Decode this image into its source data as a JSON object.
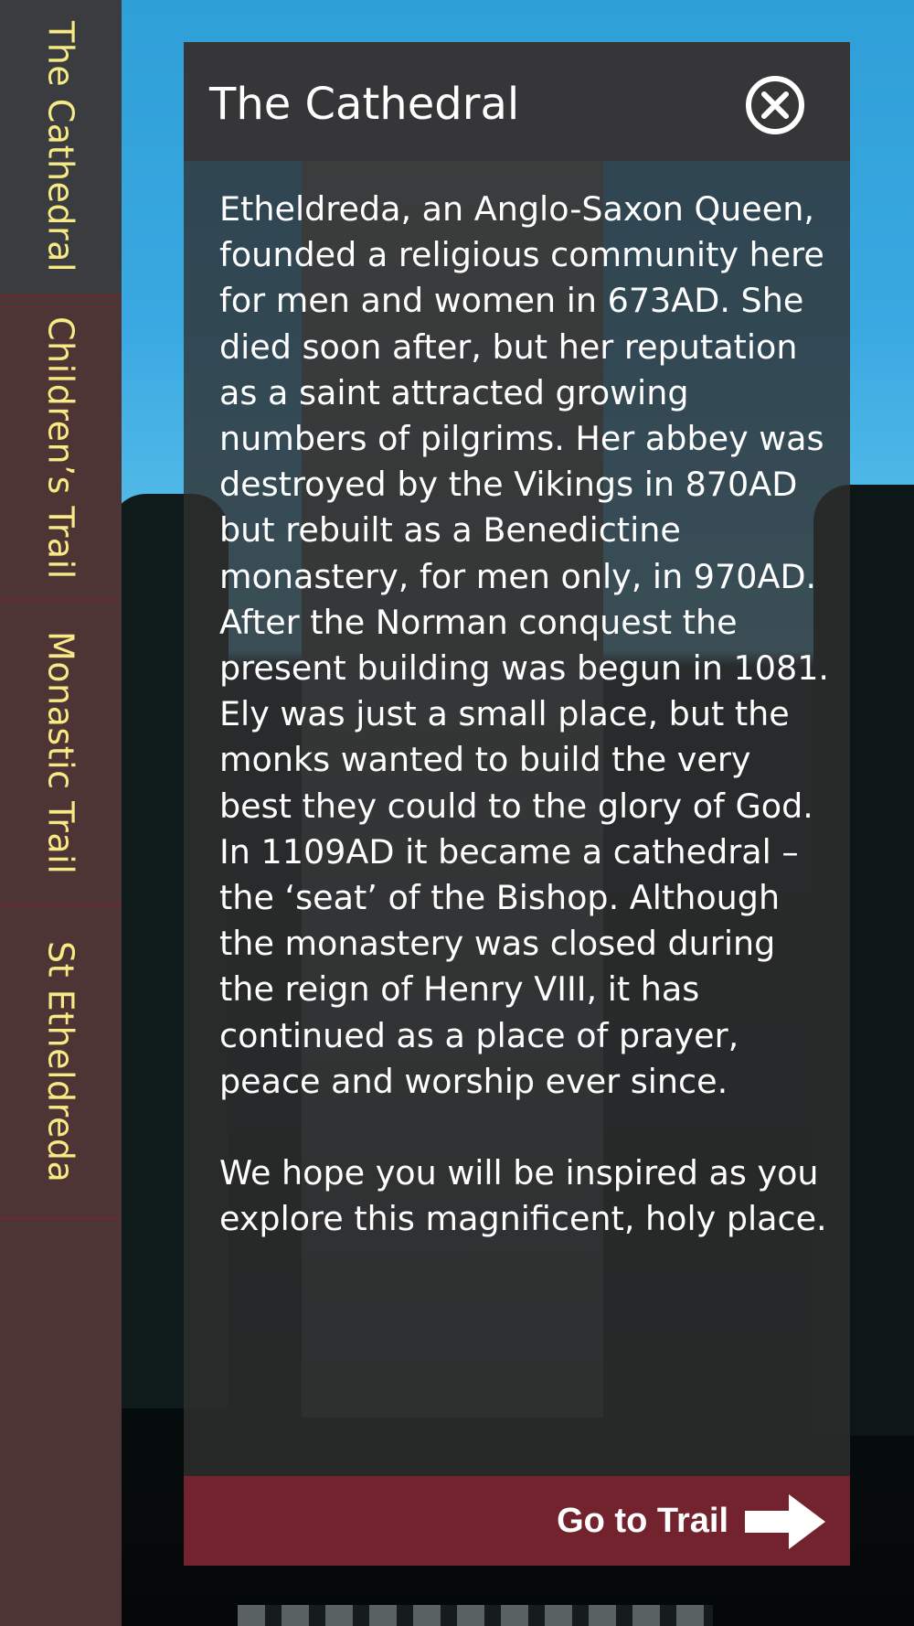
{
  "sidebar": {
    "tabs": [
      {
        "label": "The Cathedral",
        "active": true
      },
      {
        "label": "Children’s Trail",
        "active": false
      },
      {
        "label": "Monastic Trail",
        "active": false
      },
      {
        "label": "St Etheldreda",
        "active": false
      }
    ]
  },
  "panel": {
    "title": "The Cathedral",
    "close_icon": "close-circle-x",
    "paragraphs": [
      "Etheldreda, an Anglo-Saxon Queen, founded a religious community here for men and women in 673AD. She died soon after, but her reputation as a saint attracted growing numbers of pilgrims. Her abbey was destroyed by the Vikings in 870AD but rebuilt as a Benedictine monastery, for men only, in 970AD. After the Norman conquest the present building was begun in 1081. Ely was just a small place, but the monks wanted to build the very best they could to the glory of God. In 1109AD it became a cathedral – the ‘seat’ of the Bishop. Although the monastery was closed during the reign of Henry VIII, it has continued as a place of prayer, peace and worship ever since.",
      "We hope you will be inspired as you explore this magnificent, holy place."
    ],
    "footer": {
      "label": "Go to Trail",
      "arrow_icon": "right-arrow"
    }
  },
  "colors": {
    "sidebar_bg": "#4d3435",
    "sidebar_active_bg": "#3b3c3f",
    "tab_text": "#f7ea85",
    "panel_header_bg": "#363638",
    "footer_bg": "#73232e",
    "text": "#ffffff"
  }
}
